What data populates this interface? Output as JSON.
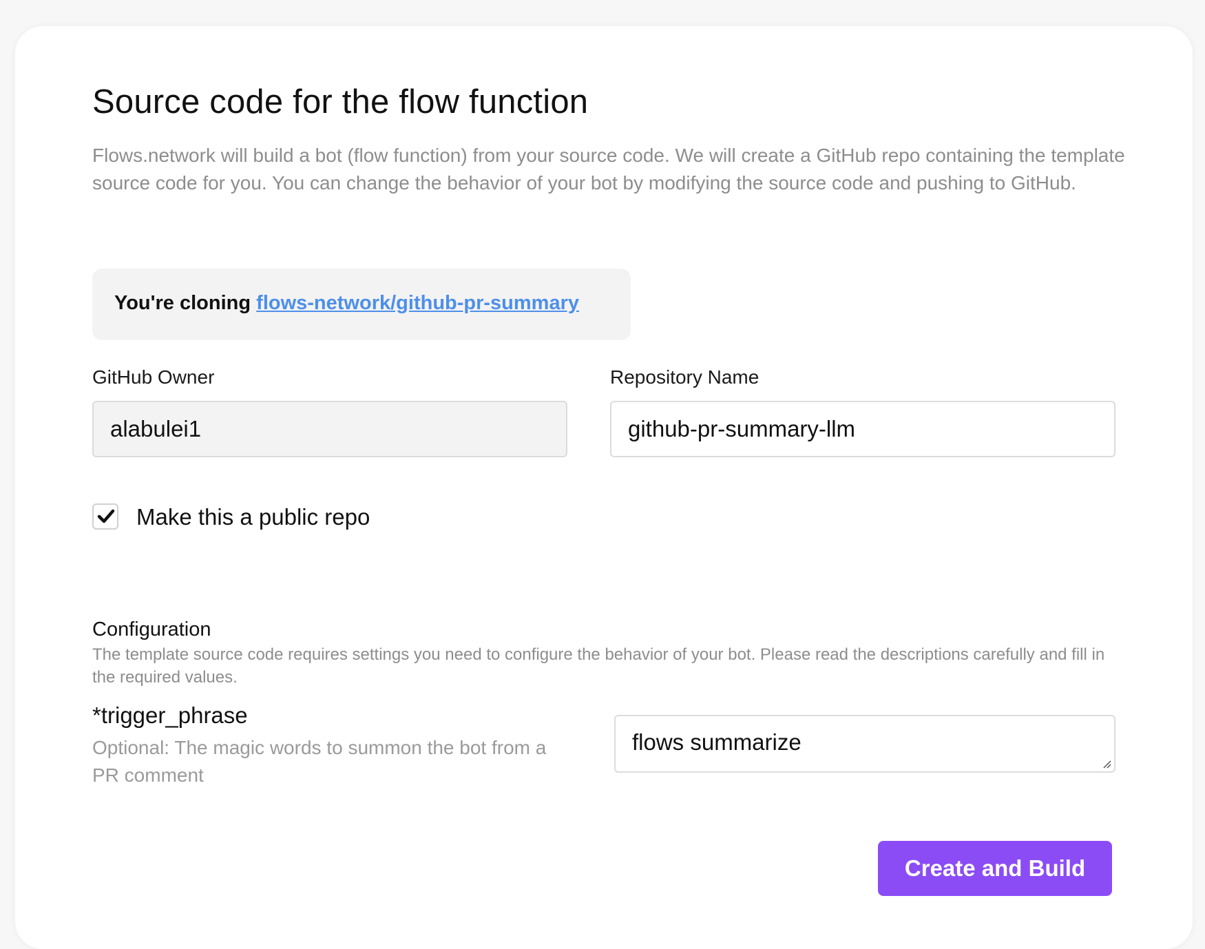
{
  "header": {
    "title": "Source code for the flow function",
    "description": "Flows.network will build a bot (flow function) from your source code. We will create a GitHub repo containing the template source code for you. You can change the behavior of your bot by modifying the source code and pushing to GitHub."
  },
  "clone": {
    "prefix": "You're cloning ",
    "repo_link": "flows-network/github-pr-summary"
  },
  "form": {
    "owner_label": "GitHub Owner",
    "owner_value": "alabulei1",
    "repo_label": "Repository Name",
    "repo_value": "github-pr-summary-llm",
    "public_checked": true,
    "public_label": "Make this a public repo"
  },
  "configuration": {
    "title": "Configuration",
    "description": "The template source code requires settings you need to configure the behavior of your bot. Please read the descriptions carefully and fill in the required values.",
    "fields": [
      {
        "name": "*trigger_phrase",
        "description": "Optional: The magic words to summon the bot from a PR comment",
        "value": "flows summarize"
      }
    ]
  },
  "actions": {
    "submit_label": "Create and Build"
  },
  "colors": {
    "accent": "#8b4cf6",
    "link": "#4d8fea",
    "muted_text": "#8d8d8d"
  }
}
